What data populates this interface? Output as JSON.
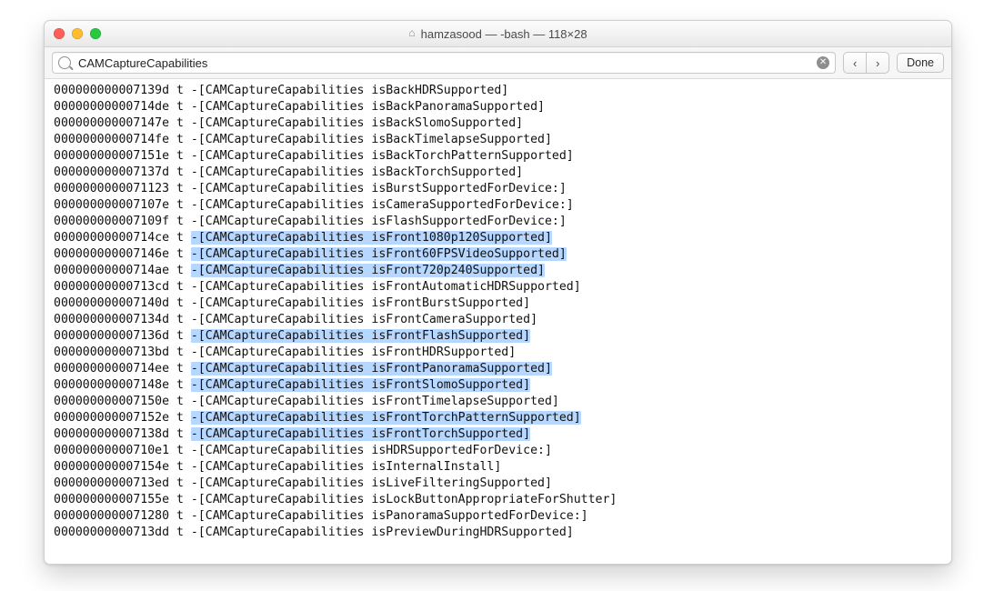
{
  "window": {
    "title": "hamzasood — -bash — 118×28"
  },
  "toolbar": {
    "search_value": "CAMCaptureCapabilities",
    "clear_label": "✕",
    "prev_label": "‹",
    "next_label": "›",
    "done_label": "Done"
  },
  "lines": [
    {
      "addr": "000000000007139d",
      "flag": "t",
      "sym": "-[CAMCaptureCapabilities isBackHDRSupported]",
      "hl": false
    },
    {
      "addr": "00000000000714de",
      "flag": "t",
      "sym": "-[CAMCaptureCapabilities isBackPanoramaSupported]",
      "hl": false
    },
    {
      "addr": "000000000007147e",
      "flag": "t",
      "sym": "-[CAMCaptureCapabilities isBackSlomoSupported]",
      "hl": false
    },
    {
      "addr": "00000000000714fe",
      "flag": "t",
      "sym": "-[CAMCaptureCapabilities isBackTimelapseSupported]",
      "hl": false
    },
    {
      "addr": "000000000007151e",
      "flag": "t",
      "sym": "-[CAMCaptureCapabilities isBackTorchPatternSupported]",
      "hl": false
    },
    {
      "addr": "000000000007137d",
      "flag": "t",
      "sym": "-[CAMCaptureCapabilities isBackTorchSupported]",
      "hl": false
    },
    {
      "addr": "0000000000071123",
      "flag": "t",
      "sym": "-[CAMCaptureCapabilities isBurstSupportedForDevice:]",
      "hl": false
    },
    {
      "addr": "000000000007107e",
      "flag": "t",
      "sym": "-[CAMCaptureCapabilities isCameraSupportedForDevice:]",
      "hl": false
    },
    {
      "addr": "000000000007109f",
      "flag": "t",
      "sym": "-[CAMCaptureCapabilities isFlashSupportedForDevice:]",
      "hl": false
    },
    {
      "addr": "00000000000714ce",
      "flag": "t",
      "sym": "-[CAMCaptureCapabilities isFront1080p120Supported]",
      "hl": true
    },
    {
      "addr": "000000000007146e",
      "flag": "t",
      "sym": "-[CAMCaptureCapabilities isFront60FPSVideoSupported]",
      "hl": true
    },
    {
      "addr": "00000000000714ae",
      "flag": "t",
      "sym": "-[CAMCaptureCapabilities isFront720p240Supported]",
      "hl": true
    },
    {
      "addr": "00000000000713cd",
      "flag": "t",
      "sym": "-[CAMCaptureCapabilities isFrontAutomaticHDRSupported]",
      "hl": false
    },
    {
      "addr": "000000000007140d",
      "flag": "t",
      "sym": "-[CAMCaptureCapabilities isFrontBurstSupported]",
      "hl": false
    },
    {
      "addr": "000000000007134d",
      "flag": "t",
      "sym": "-[CAMCaptureCapabilities isFrontCameraSupported]",
      "hl": false
    },
    {
      "addr": "000000000007136d",
      "flag": "t",
      "sym": "-[CAMCaptureCapabilities isFrontFlashSupported]",
      "hl": true
    },
    {
      "addr": "00000000000713bd",
      "flag": "t",
      "sym": "-[CAMCaptureCapabilities isFrontHDRSupported]",
      "hl": false
    },
    {
      "addr": "00000000000714ee",
      "flag": "t",
      "sym": "-[CAMCaptureCapabilities isFrontPanoramaSupported]",
      "hl": true
    },
    {
      "addr": "000000000007148e",
      "flag": "t",
      "sym": "-[CAMCaptureCapabilities isFrontSlomoSupported]",
      "hl": true
    },
    {
      "addr": "000000000007150e",
      "flag": "t",
      "sym": "-[CAMCaptureCapabilities isFrontTimelapseSupported]",
      "hl": false
    },
    {
      "addr": "000000000007152e",
      "flag": "t",
      "sym": "-[CAMCaptureCapabilities isFrontTorchPatternSupported]",
      "hl": true
    },
    {
      "addr": "000000000007138d",
      "flag": "t",
      "sym": "-[CAMCaptureCapabilities isFrontTorchSupported]",
      "hl": true
    },
    {
      "addr": "00000000000710e1",
      "flag": "t",
      "sym": "-[CAMCaptureCapabilities isHDRSupportedForDevice:]",
      "hl": false
    },
    {
      "addr": "000000000007154e",
      "flag": "t",
      "sym": "-[CAMCaptureCapabilities isInternalInstall]",
      "hl": false
    },
    {
      "addr": "00000000000713ed",
      "flag": "t",
      "sym": "-[CAMCaptureCapabilities isLiveFilteringSupported]",
      "hl": false
    },
    {
      "addr": "000000000007155e",
      "flag": "t",
      "sym": "-[CAMCaptureCapabilities isLockButtonAppropriateForShutter]",
      "hl": false
    },
    {
      "addr": "0000000000071280",
      "flag": "t",
      "sym": "-[CAMCaptureCapabilities isPanoramaSupportedForDevice:]",
      "hl": false
    },
    {
      "addr": "00000000000713dd",
      "flag": "t",
      "sym": "-[CAMCaptureCapabilities isPreviewDuringHDRSupported]",
      "hl": false
    }
  ]
}
